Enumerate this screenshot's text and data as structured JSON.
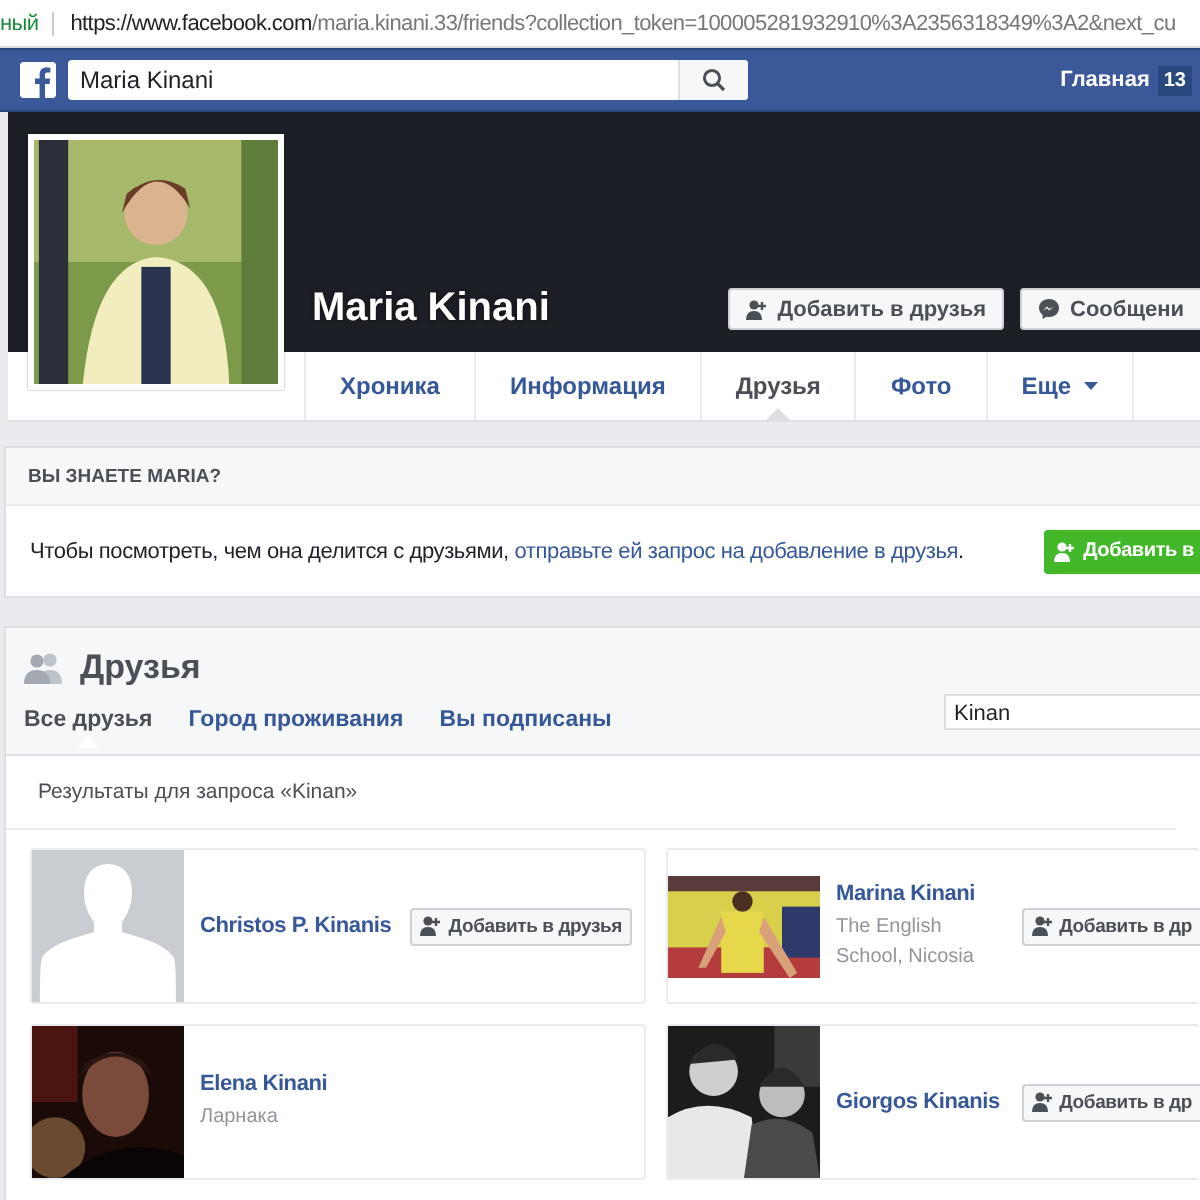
{
  "browser": {
    "security_label": "ный",
    "url_host": "https://www.facebook.com",
    "url_path": "/maria.kinani.33/friends?collection_token=100005281932910%3A2356318349%3A2&next_cu"
  },
  "topbar": {
    "search_value": "Maria Kinani",
    "home_label": "Главная",
    "home_count": "13"
  },
  "profile": {
    "name": "Maria Kinani",
    "actions": [
      {
        "label": "Добавить в друзья",
        "kind": "add"
      },
      {
        "label": "Сообщени",
        "kind": "message"
      }
    ]
  },
  "tabs": [
    {
      "label": "Хроника",
      "selected": false,
      "has_caret": false
    },
    {
      "label": "Информация",
      "selected": false,
      "has_caret": false
    },
    {
      "label": "Друзья",
      "selected": true,
      "has_caret": false
    },
    {
      "label": "Фото",
      "selected": false,
      "has_caret": false
    },
    {
      "label": "Еще",
      "selected": false,
      "has_caret": true
    }
  ],
  "know_card": {
    "title": "ВЫ ЗНАЕТЕ MARIA?",
    "text": "Чтобы посмотреть, чем она делится с друзьями, ",
    "link": "отправьте ей запрос на добавление в друзья",
    "after": ".",
    "button": "Добавить в"
  },
  "friends": {
    "title": "Друзья",
    "filters": [
      {
        "label": "Все друзья",
        "selected": true
      },
      {
        "label": "Город проживания",
        "selected": false
      },
      {
        "label": "Вы подписаны",
        "selected": false
      }
    ],
    "search_value": "Kinan",
    "results_label": "Результаты для запроса «Kinan»",
    "people": [
      {
        "name": "Christos P. Kinanis",
        "photo": {
          "kind": "silhouette"
        },
        "button": "Добавить в друзья"
      },
      {
        "name": "Marina Kinani",
        "detail": "The English School, Nicosia",
        "button": "Добавить в др"
      },
      {
        "name": "Elena Kinani",
        "detail": "Ларнака"
      },
      {
        "name": "Giorgos Kinanis",
        "button": "Добавить в др"
      }
    ]
  }
}
